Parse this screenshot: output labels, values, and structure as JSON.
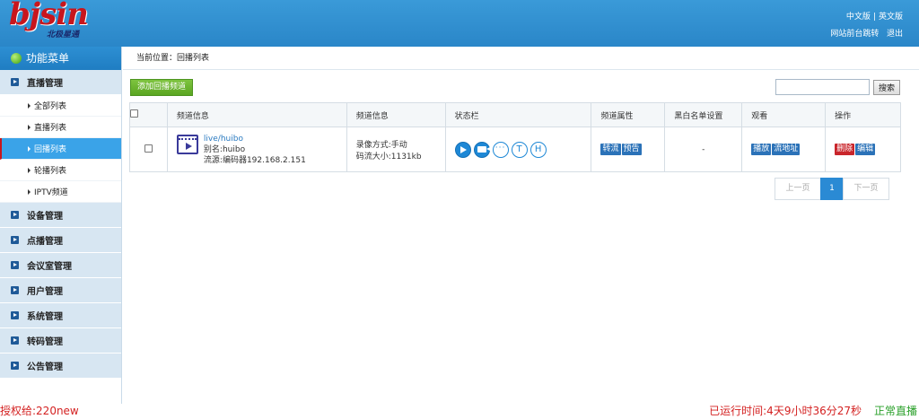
{
  "header": {
    "logo_text": "bjsin",
    "logo_sub": "北极星通",
    "lang_cn": "中文版",
    "lang_sep": "|",
    "lang_en": "英文版",
    "front_link": "网站前台跳转",
    "logout": "退出"
  },
  "sidebar": {
    "title": "功能菜单",
    "live_group": "直播管理",
    "live_items": [
      "全部列表",
      "直播列表",
      "回播列表",
      "轮播列表",
      "IPTV频道"
    ],
    "active_item": "回播列表",
    "groups": [
      "设备管理",
      "点播管理",
      "会议室管理",
      "用户管理",
      "系统管理",
      "转码管理",
      "公告管理"
    ]
  },
  "main": {
    "breadcrumb": "当前位置：回播列表",
    "add_button": "添加回播频道",
    "search_placeholder": "",
    "search_button": "搜索",
    "columns": [
      "频道信息",
      "频道信息",
      "状态栏",
      "频道属性",
      "黑白名单设置",
      "观看",
      "操作"
    ],
    "row": {
      "channel_link": "live/huibo",
      "alias": "别名:huibo",
      "source": "流源:编码器192.168.2.151",
      "record_mode": "录像方式:手动",
      "stream_size": "码流大小:1131kb",
      "status_t": "T",
      "status_h": "H",
      "attr_tags": [
        "转流",
        "预告"
      ],
      "blacklist": "-",
      "watch_tags": [
        "播放",
        "流地址"
      ],
      "op_delete": "删除",
      "op_edit": "编辑"
    },
    "pager": {
      "prev": "上一页",
      "current": "1",
      "next": "下一页"
    }
  },
  "footer": {
    "license": "授权给:220new",
    "runtime": "已运行时间:4天9小时36分27秒",
    "state": "正常直播"
  },
  "colors": {
    "header_blue": "#2a86c8",
    "active_blue": "#3aa3e8",
    "logo_red": "#c8161d",
    "footer_red": "#d42222",
    "footer_green": "#2aa02a"
  }
}
